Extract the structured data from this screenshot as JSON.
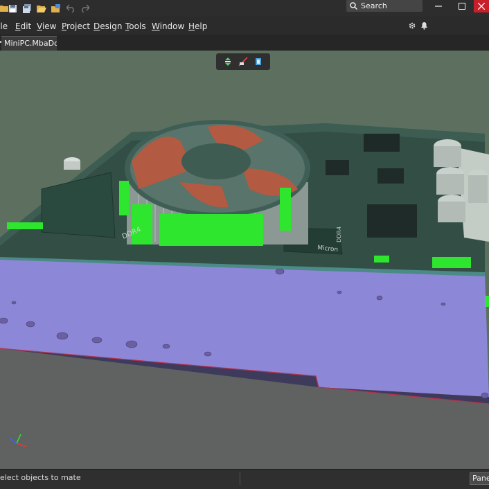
{
  "search": {
    "label": "Search"
  },
  "menu": {
    "file": "File",
    "edit": {
      "first": "E",
      "rest": "dit"
    },
    "view": {
      "first": "V",
      "rest": "iew"
    },
    "project": {
      "first": "P",
      "rest": "roject"
    },
    "design": {
      "first": "D",
      "rest": "esign"
    },
    "tools": {
      "first": "T",
      "rest": "ools"
    },
    "window": {
      "first": "W",
      "rest": "indow"
    },
    "help": {
      "first": "H",
      "rest": "elp"
    }
  },
  "document_tab": {
    "label": "MiniPC.MbaDoc"
  },
  "board": {
    "silkscreen": [
      "DDR4",
      "Micron",
      "DDR4"
    ],
    "colors": {
      "background": "#5d7060",
      "substrate": "#8d87d8",
      "pcb": "#324e45",
      "fan_blade": "#b25a42",
      "highlight_green": "#2ee62e"
    }
  },
  "status": {
    "message": "Select objects to mate"
  },
  "panels_button": {
    "label": "Panels"
  }
}
